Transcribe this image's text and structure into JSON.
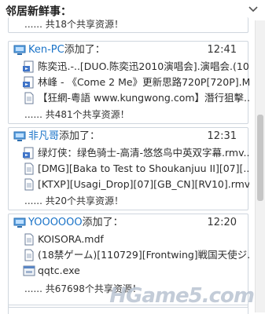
{
  "title": "邻居新鲜事：",
  "top_more": "...... 共18个共享资源！",
  "posts": [
    {
      "user": "Ken-PC",
      "action": "添加了：",
      "time": "12:41",
      "files": [
        {
          "icon": "video-file-icon",
          "name": "陈奕迅.-..[DUO.陈奕迅2010演唱会].演唱会.(10..."
        },
        {
          "icon": "video-file-icon",
          "name": "林峰 - 《Come 2 Me》更新思路720P[720P].M..."
        },
        {
          "icon": "document-file-icon",
          "name": "【狂網-粵語 www.kungwong.com】潛行狙擊..."
        }
      ],
      "more": "...... 共481个共享资源！"
    },
    {
      "user": "非凡哥",
      "action": "添加了：",
      "time": "12:31",
      "files": [
        {
          "icon": "video-file-icon",
          "name": "绿灯侠：绿色骑士-高清-悠悠鸟中英双字幕.rmv..."
        },
        {
          "icon": "document-file-icon",
          "name": "[DMG][Baka to Test to Shoukanjuu II][07][..."
        },
        {
          "icon": "document-file-icon",
          "name": "[KTXP][Usagi_Drop][07][GB_CN][RV10].rmvb"
        }
      ],
      "more": "...... 共20个共享资源！"
    },
    {
      "user": "YOOOOOO",
      "action": "添加了：",
      "time": "12:20",
      "files": [
        {
          "icon": "document-file-icon",
          "name": "KOISORA.mdf"
        },
        {
          "icon": "document-file-icon",
          "name": "(18禁ゲーム)[110729][Frontwing]戦国天使ジ..."
        },
        {
          "icon": "executable-file-icon",
          "name": "qqtc.exe"
        }
      ],
      "more": "...... 共67698个共享资源！"
    }
  ],
  "watermark": "HGame5.com"
}
